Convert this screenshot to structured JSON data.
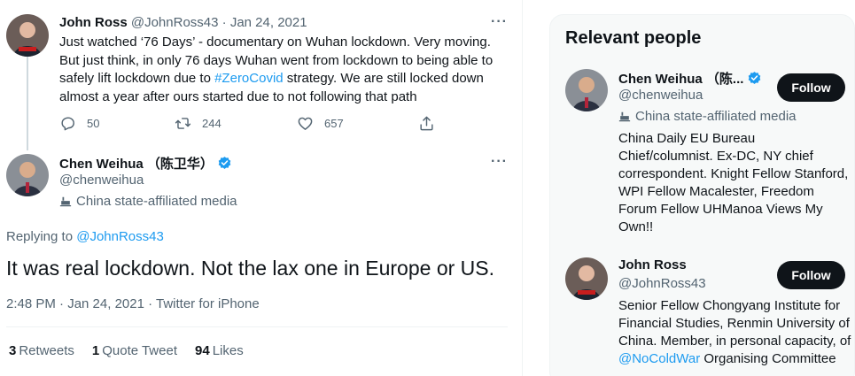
{
  "parent_tweet": {
    "author_name": "John Ross",
    "handle": "@JohnRoss43",
    "date": "Jan 24, 2021",
    "text_before": "Just watched ‘76 Days’ - documentary on Wuhan lockdown. Very moving. But just think, in only 76 days Wuhan went from lockdown to being able to safely lift lockdown due to ",
    "hashtag": "#ZeroCovid",
    "text_after": " strategy. We are still locked down almost a year after ours started due to not following that path",
    "replies": "50",
    "retweets": "244",
    "likes": "657",
    "more_label": "···"
  },
  "focus_tweet": {
    "author_name": "Chen Weihua （陈卫华）",
    "handle": "@chenweihua",
    "affiliation_label": "China state-affiliated media",
    "replying_prefix": "Replying to ",
    "replying_to": "@JohnRoss43",
    "text": "It was real lockdown.  Not the lax one in Europe or US.",
    "timestamp": "2:48 PM · Jan 24, 2021 · Twitter for iPhone",
    "retweets_count": "3",
    "retweets_label": "Retweets",
    "quote_count": "1",
    "quote_label": "Quote Tweet",
    "likes_count": "94",
    "likes_label": "Likes",
    "more_label": "···"
  },
  "relevant_people": {
    "title": "Relevant people",
    "people": [
      {
        "name": "Chen Weihua （陈...",
        "handle": "@chenweihua",
        "affiliation_label": "China state-affiliated media",
        "bio": "China Daily EU Bureau Chief/columnist. Ex-DC, NY chief correspondent. Knight Fellow Stanford, WPI Fellow Macalester, Freedom Forum Fellow UHManoa Views My Own!!",
        "follow_label": "Follow"
      },
      {
        "name": "John Ross",
        "handle": "@JohnRoss43",
        "bio_before": "Senior Fellow Chongyang Institute for Financial Studies, Renmin University of China. Member, in personal capacity, of ",
        "bio_mention": "@NoColdWar",
        "bio_after": " Organising Committee",
        "follow_label": "Follow"
      }
    ]
  },
  "colors": {
    "link": "#1d9bf0",
    "text_primary": "#0f1419",
    "text_secondary": "#536471",
    "button": "#0f1419",
    "panel_bg": "#f7f9f9"
  },
  "icons": [
    "reply-icon",
    "retweet-icon",
    "like-icon",
    "share-icon",
    "verified-icon",
    "state-media-icon",
    "more-icon"
  ]
}
